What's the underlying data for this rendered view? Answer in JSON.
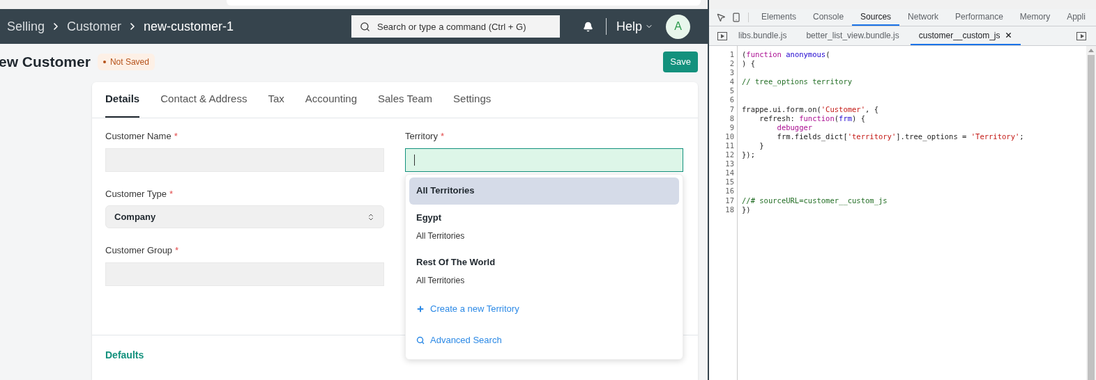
{
  "navbar": {
    "breadcrumbs": [
      "Selling",
      "Customer",
      "new-customer-1"
    ],
    "search": {
      "placeholder": "Search or type a command (Ctrl + G)"
    },
    "help": "Help",
    "avatar": "A"
  },
  "page_head": {
    "title": "ew Customer",
    "status": "Not Saved",
    "save": "Save"
  },
  "form": {
    "tabs": [
      {
        "label": "Details",
        "selected": true
      },
      {
        "label": "Contact & Address",
        "selected": false
      },
      {
        "label": "Tax",
        "selected": false
      },
      {
        "label": "Accounting",
        "selected": false
      },
      {
        "label": "Sales Team",
        "selected": false
      },
      {
        "label": "Settings",
        "selected": false
      }
    ],
    "left_fields": [
      {
        "label": "Customer Name",
        "required_mark": "*",
        "kind": "text"
      },
      {
        "label": "Customer Type",
        "required_mark": "*",
        "kind": "select",
        "value": "Company"
      },
      {
        "label": "Customer Group",
        "required_mark": "*",
        "kind": "text"
      }
    ],
    "territory": {
      "label": "Territory",
      "required_mark": "*",
      "focused": true,
      "options": [
        {
          "title": "All Territories",
          "selected": true
        },
        {
          "title": "Egypt",
          "subtitle": "All Territories",
          "selected": false
        },
        {
          "title": "Rest Of The World",
          "subtitle": "All Territories",
          "selected": false
        }
      ],
      "actions": [
        {
          "kind": "create",
          "label": "Create a new Territory"
        },
        {
          "kind": "search",
          "label": "Advanced Search"
        }
      ]
    },
    "section": "Defaults"
  },
  "devtools": {
    "tabs": [
      {
        "label": "Elements",
        "selected": false
      },
      {
        "label": "Console",
        "selected": false
      },
      {
        "label": "Sources",
        "selected": true
      },
      {
        "label": "Network",
        "selected": false
      },
      {
        "label": "Performance",
        "selected": false
      },
      {
        "label": "Memory",
        "selected": false
      },
      {
        "label": "Appli",
        "selected": false
      }
    ],
    "files": [
      {
        "label": "libs.bundle.js",
        "selected": false
      },
      {
        "label": "better_list_view.bundle.js",
        "selected": false
      },
      {
        "label": "customer__custom_js",
        "selected": true
      }
    ],
    "code": [
      {
        "number": "1",
        "tokens": [
          {
            "text": "(",
            "kind": "plain"
          },
          {
            "text": "function ",
            "kind": "keyword"
          },
          {
            "text": "anonymous",
            "kind": "def"
          },
          {
            "text": "(",
            "kind": "plain"
          }
        ]
      },
      {
        "number": "2",
        "tokens": [
          {
            "text": ") {",
            "kind": "plain"
          }
        ]
      },
      {
        "number": "3"
      },
      {
        "number": "4",
        "tokens": [
          {
            "text": "// tree_options territory",
            "kind": "comment"
          }
        ]
      },
      {
        "number": "5"
      },
      {
        "number": "6"
      },
      {
        "number": "7",
        "tokens": [
          {
            "text": "frappe.ui.form.on(",
            "kind": "plain"
          },
          {
            "text": "'Customer'",
            "kind": "string"
          },
          {
            "text": ", {",
            "kind": "plain"
          }
        ]
      },
      {
        "number": "8",
        "tokens": [
          {
            "text": "    refresh: ",
            "kind": "plain"
          },
          {
            "text": "function",
            "kind": "keyword"
          },
          {
            "text": "(",
            "kind": "plain"
          },
          {
            "text": "frm",
            "kind": "def"
          },
          {
            "text": ") {",
            "kind": "plain"
          }
        ]
      },
      {
        "number": "9",
        "tokens": [
          {
            "text": "        debugger",
            "kind": "keyword"
          }
        ]
      },
      {
        "number": "10",
        "tokens": [
          {
            "text": "        frm.fields_dict[",
            "kind": "plain"
          },
          {
            "text": "'territory'",
            "kind": "string"
          },
          {
            "text": "].tree_options = ",
            "kind": "plain"
          },
          {
            "text": "'Territory'",
            "kind": "string"
          },
          {
            "text": ";",
            "kind": "plain"
          }
        ]
      },
      {
        "number": "11",
        "tokens": [
          {
            "text": "    }",
            "kind": "plain"
          }
        ]
      },
      {
        "number": "12",
        "tokens": [
          {
            "text": "});",
            "kind": "plain"
          }
        ]
      },
      {
        "number": "13"
      },
      {
        "number": "14"
      },
      {
        "number": "15"
      },
      {
        "number": "16"
      },
      {
        "number": "17",
        "tokens": [
          {
            "text": "//# sourceURL=customer__custom_js",
            "kind": "comment"
          }
        ]
      },
      {
        "number": "18",
        "tokens": [
          {
            "text": "})",
            "kind": "plain"
          }
        ]
      }
    ]
  }
}
